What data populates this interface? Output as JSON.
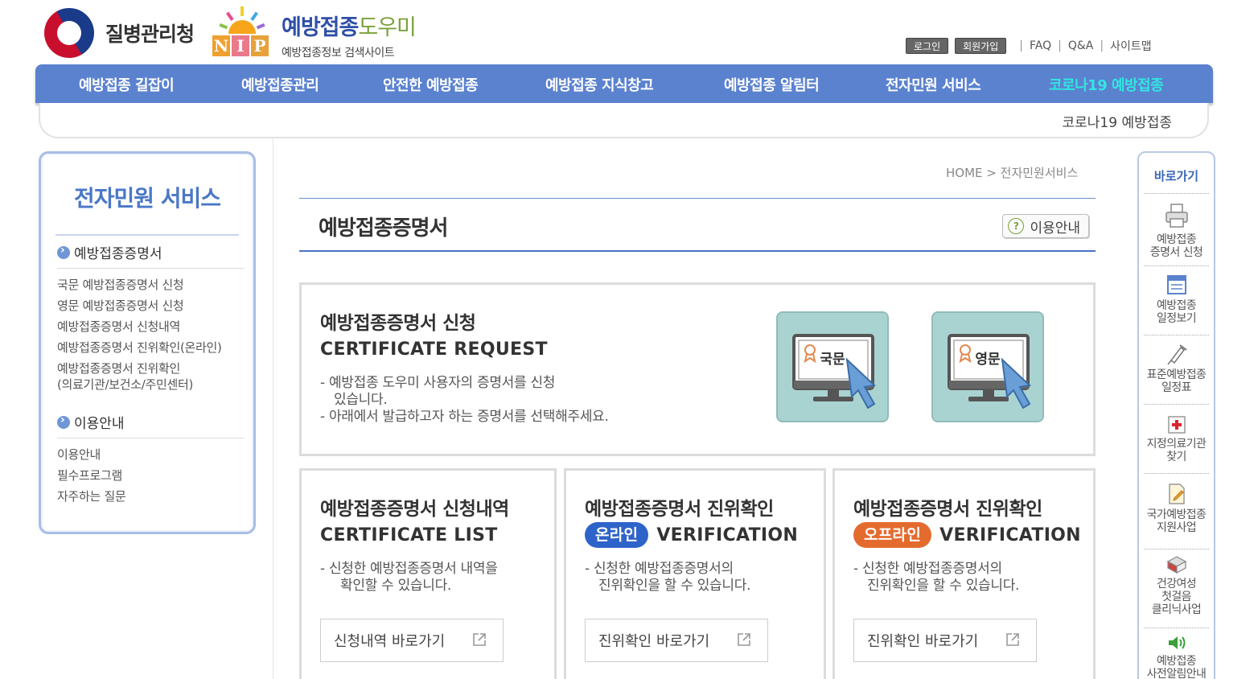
{
  "header": {
    "agency_name": "질병관리청",
    "nip_letters": [
      "N",
      "I",
      "P"
    ],
    "brand_title_main": "예방접종",
    "brand_title_accent": "도우미",
    "brand_subtitle": "예방접종정보 검색사이트",
    "login_label": "로그인",
    "join_label": "회원가입",
    "faq_label": "FAQ",
    "qna_label": "Q&A",
    "sitemap_label": "사이트맵"
  },
  "gnb": {
    "items": [
      "예방접종 길잡이",
      "예방접종관리",
      "안전한 예방접종",
      "예방접종 지식창고",
      "예방접종 알림터",
      "전자민원 서비스",
      "코로나19 예방접종"
    ],
    "highlight_color": "#32e6e0",
    "bar_color": "#5b82cf",
    "sub_item": "코로나19 예방접종"
  },
  "lnb": {
    "title": "전자민원 서비스",
    "section1": "예방접종증명서",
    "section1_links": [
      "국문 예방접종증명서 신청",
      "영문 예방접종증명서 신청",
      "예방접종증명서 신청내역",
      "예방접종증명서 진위확인(온라인)",
      "예방접종증명서 진위확인",
      "(의료기관/보건소/주민센터)"
    ],
    "section2": "이용안내",
    "section2_links": [
      "이용안내",
      "필수프로그램",
      "자주하는 질문"
    ]
  },
  "content": {
    "breadcrumb_home": "HOME",
    "breadcrumb_sep": ">",
    "breadcrumb_current": "전자민원서비스",
    "page_title": "예방접종증명서",
    "guide_button": "이용안내",
    "request": {
      "heading": "예방접종증명서 신청",
      "english": "CERTIFICATE REQUEST",
      "desc1": "- 예방접종 도우미 사용자의 증명서를 신청",
      "desc1b": "있습니다.",
      "desc2": "- 아래에서 발급하고자 하는 증명서를 선택해주세요.",
      "korean_card": "국문",
      "english_card": "영문"
    },
    "list": {
      "heading": "예방접종증명서 신청내역",
      "english": "CERTIFICATE LIST",
      "desc1": "- 신청한 예방접종증명서 내역을",
      "desc2": "확인할 수 있습니다.",
      "button": "신청내역 바로가기"
    },
    "online": {
      "heading": "예방접종증명서 진위확인",
      "pill": "온라인",
      "pill_color": "#2e63c9",
      "english": "VERIFICATION",
      "desc1": "- 신청한 예방접종증명서의",
      "desc2": "진위확인을 할 수 있습니다.",
      "button": "진위확인 바로가기"
    },
    "offline": {
      "heading": "예방접종증명서 진위확인",
      "pill": "오프라인",
      "pill_color": "#e46b2e",
      "english": "VERIFICATION",
      "desc1": "- 신청한 예방접종증명서의",
      "desc2": "진위확인을 할 수 있습니다.",
      "button": "진위확인 바로가기"
    }
  },
  "quick": {
    "title": "바로가기",
    "items": [
      {
        "icon": "printer-icon",
        "line1": "예방접종",
        "line2": "증명서 신청"
      },
      {
        "icon": "schedule-icon",
        "line1": "예방접종",
        "line2": "일정보기"
      },
      {
        "icon": "syringe-icon",
        "line1": "표준예방접종",
        "line2": "일정표"
      },
      {
        "icon": "hospital-icon",
        "line1": "지정의료기관",
        "line2": "찾기"
      },
      {
        "icon": "document-icon",
        "line1": "국가예방접종",
        "line2": "지원사업"
      },
      {
        "icon": "clinic-icon",
        "line1": "건강여성",
        "line2": "첫걸음",
        "line3": "클리닉사업"
      },
      {
        "icon": "speaker-icon",
        "line1": "예방접종",
        "line2": "사전알림안내"
      }
    ]
  }
}
